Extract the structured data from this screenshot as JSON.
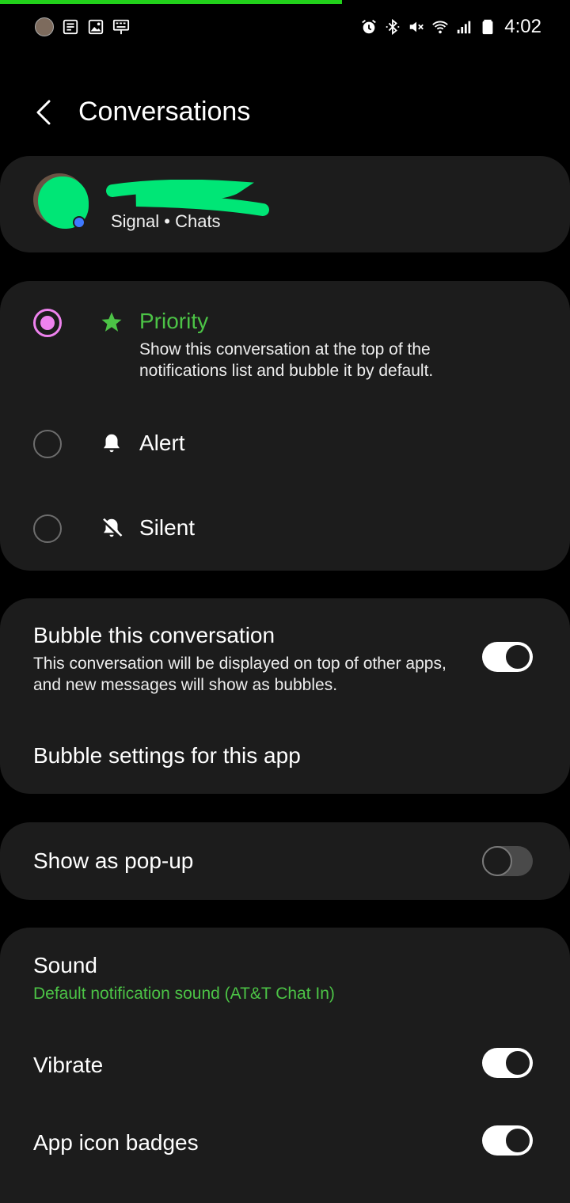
{
  "status_bar": {
    "time": "4:02",
    "left_icons": [
      "avatar-notification",
      "news-icon",
      "image-icon",
      "keyboard-icon"
    ],
    "right_icons": [
      "alarm-icon",
      "bluetooth-icon",
      "mute-icon",
      "wifi-icon",
      "signal-icon",
      "battery-icon"
    ]
  },
  "colors": {
    "background": "#000000",
    "card": "#1c1c1c",
    "accent_green": "#4cc346",
    "radio_selected": "#ee82ee",
    "progress_bar": "#22d11b"
  },
  "header": {
    "title": "Conversations"
  },
  "contact": {
    "subtitle": "Signal • Chats"
  },
  "importance": {
    "options": [
      {
        "label": "Priority",
        "description": "Show this conversation at the top of the notifications list and bubble it by default.",
        "icon": "star-icon",
        "selected": true
      },
      {
        "label": "Alert",
        "icon": "bell-icon",
        "selected": false
      },
      {
        "label": "Silent",
        "icon": "bell-off-icon",
        "selected": false
      }
    ]
  },
  "bubble": {
    "title": "Bubble this conversation",
    "description": "This conversation will be displayed on top of other apps, and new messages will show as bubbles.",
    "enabled": true,
    "settings_label": "Bubble settings for this app"
  },
  "popup": {
    "title": "Show as pop-up",
    "enabled": false
  },
  "sound": {
    "title": "Sound",
    "value": "Default notification sound (AT&T Chat In)"
  },
  "vibrate": {
    "title": "Vibrate",
    "enabled": true
  },
  "badges": {
    "title": "App icon badges",
    "enabled": true
  }
}
